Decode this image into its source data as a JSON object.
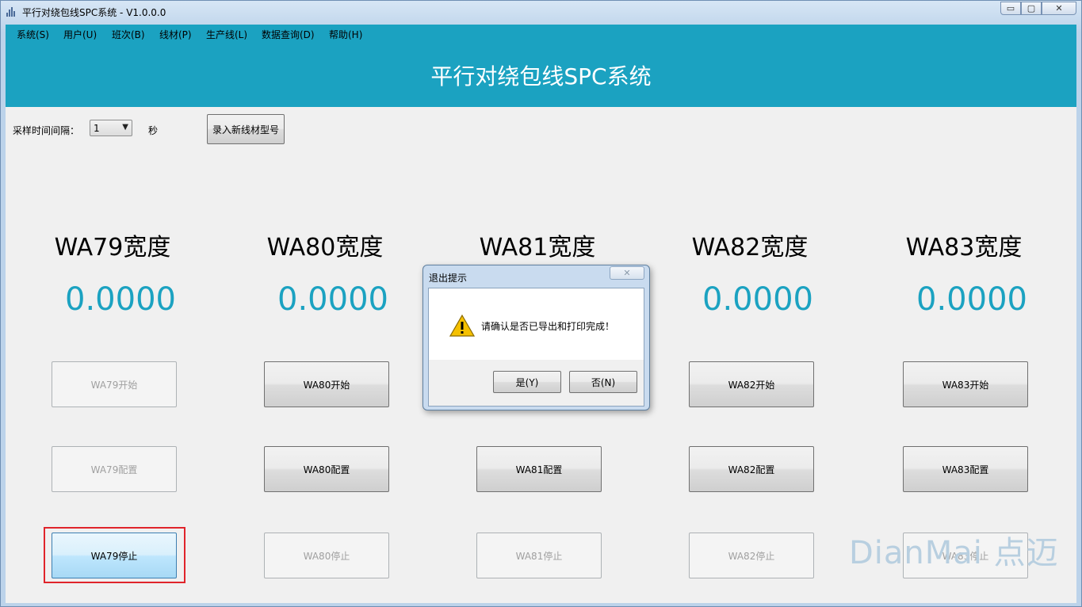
{
  "window": {
    "title": "平行对绕包线SPC系统 - V1.0.0.0"
  },
  "window_buttons": {
    "minimize": "▭",
    "maximize": "▢",
    "close": "✕"
  },
  "menu": [
    {
      "label": "系统(S)"
    },
    {
      "label": "用户(U)"
    },
    {
      "label": "班次(B)"
    },
    {
      "label": "线材(P)"
    },
    {
      "label": "生产线(L)"
    },
    {
      "label": "数据查询(D)"
    },
    {
      "label": "帮助(H)"
    }
  ],
  "banner": {
    "title": "平行对绕包线SPC系统"
  },
  "controls": {
    "sample_label": "采样时间间隔：",
    "sample_value": "1",
    "unit": "秒",
    "new_wire_button": "录入新线材型号"
  },
  "stations": [
    {
      "title": "WA79宽度",
      "value": "0.0000",
      "start": "WA79开始",
      "config": "WA79配置",
      "stop": "WA79停止",
      "start_enabled": false,
      "config_enabled": false,
      "stop_enabled": true
    },
    {
      "title": "WA80宽度",
      "value": "0.0000",
      "start": "WA80开始",
      "config": "WA80配置",
      "stop": "WA80停止",
      "start_enabled": true,
      "config_enabled": true,
      "stop_enabled": false
    },
    {
      "title": "WA81宽度",
      "value": "",
      "start": "",
      "config": "WA81配置",
      "stop": "WA81停止",
      "start_enabled": true,
      "config_enabled": true,
      "stop_enabled": false
    },
    {
      "title": "WA82宽度",
      "value": "0.0000",
      "start": "WA82开始",
      "config": "WA82配置",
      "stop": "WA82停止",
      "start_enabled": true,
      "config_enabled": true,
      "stop_enabled": false
    },
    {
      "title": "WA83宽度",
      "value": "0.0000",
      "start": "WA83开始",
      "config": "WA83配置",
      "stop": "WA83停止",
      "start_enabled": true,
      "config_enabled": true,
      "stop_enabled": false
    }
  ],
  "dialog": {
    "title": "退出提示",
    "message": "请确认是否已导出和打印完成！",
    "yes": "是(Y)",
    "no": "否(N)",
    "icon": "warning-icon"
  },
  "watermark": "DianMai 点迈",
  "colors": {
    "accent": "#1ba2c1",
    "highlight": "#e0242b"
  }
}
